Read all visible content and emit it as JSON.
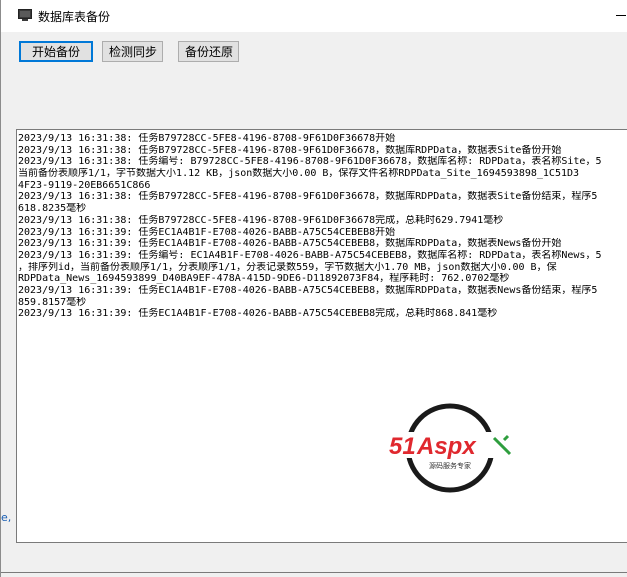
{
  "window": {
    "title": "数据库表备份",
    "title_icon": "app-window-icon",
    "minimize_icon": "minimize-icon"
  },
  "toolbar": {
    "start_backup_label": "开始备份",
    "check_sync_label": "检测同步",
    "restore_label": "备份还原"
  },
  "log": {
    "lines": [
      "2023/9/13 16:31:38: 任务B79728CC-5FE8-4196-8708-9F61D0F36678开始",
      "2023/9/13 16:31:38: 任务B79728CC-5FE8-4196-8708-9F61D0F36678，数据库RDPData，数据表Site备份开始",
      "2023/9/13 16:31:38: 任务编号: B79728CC-5FE8-4196-8708-9F61D0F36678，数据库名称: RDPData，表名称Site，5",
      "当前备份表顺序1/1，字节数据大小1.12 KB，json数据大小0.00 B，保存文件名称RDPData_Site_1694593898_1C51D3",
      "4F23-9119-20EB6651C866",
      "2023/9/13 16:31:38: 任务B79728CC-5FE8-4196-8708-9F61D0F36678，数据库RDPData，数据表Site备份结束，程序5",
      "618.8235毫秒",
      "2023/9/13 16:31:38: 任务B79728CC-5FE8-4196-8708-9F61D0F36678完成，总耗时629.7941毫秒",
      "2023/9/13 16:31:39: 任务EC1A4B1F-E708-4026-BABB-A75C54CEBEB8开始",
      "2023/9/13 16:31:39: 任务EC1A4B1F-E708-4026-BABB-A75C54CEBEB8，数据库RDPData，数据表News备份开始",
      "2023/9/13 16:31:39: 任务编号: EC1A4B1F-E708-4026-BABB-A75C54CEBEB8，数据库名称: RDPData，表名称News，5",
      "，排序列id，当前备份表顺序1/1，分表顺序1/1，分表记录数559，字节数据大小1.70 MB，json数据大小0.00 B，保",
      "RDPData_News_1694593899_D40BA9EF-478A-415D-9DE6-D11892073F84，程序耗时: 762.0702毫秒",
      "2023/9/13 16:31:39: 任务EC1A4B1F-E708-4026-BABB-A75C54CEBEB8，数据库RDPData，数据表News备份结束，程序5",
      "859.8157毫秒",
      "2023/9/13 16:31:39: 任务EC1A4B1F-E708-4026-BABB-A75C54CEBEB8完成，总耗时868.841毫秒"
    ]
  },
  "watermark": {
    "brand_number": "51",
    "brand_text": "Aspx",
    "tagline": "源码服务专家",
    "colors": {
      "number": "#e0282e",
      "text": "#e0282e",
      "x_accent": "#2e9e3e",
      "ring": "#1a1a1a"
    }
  },
  "stray_glyph": "e,"
}
